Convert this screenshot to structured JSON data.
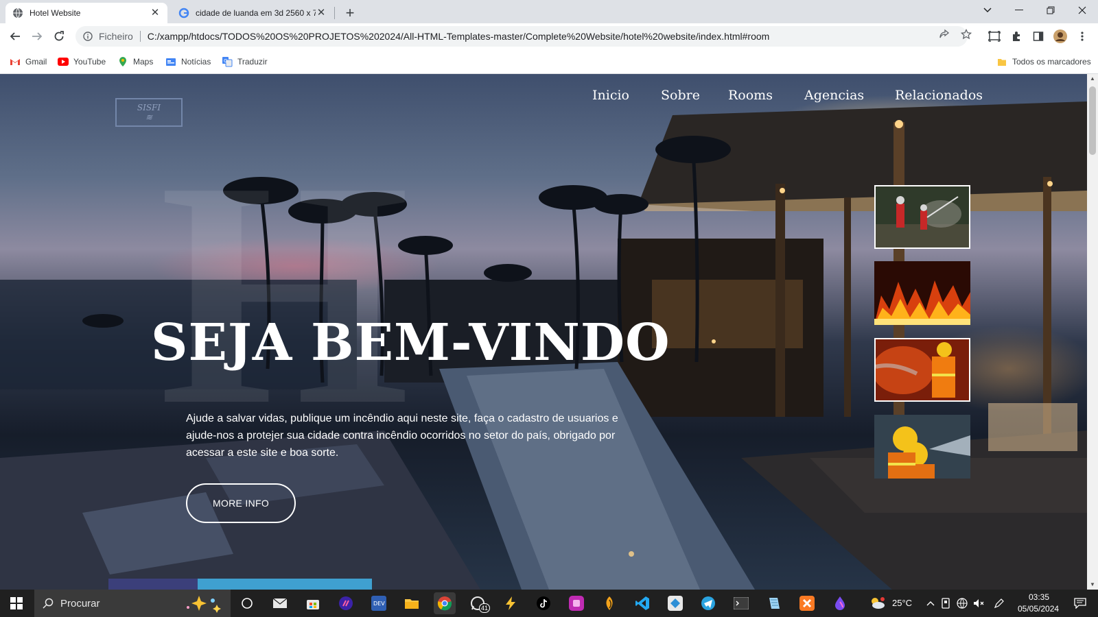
{
  "browser": {
    "tabs": [
      {
        "title": "Hotel Website",
        "active": true
      },
      {
        "title": "cidade de luanda em 3d 2560 x 7",
        "active": false
      }
    ],
    "address": {
      "scheme_label": "Ficheiro",
      "url": "C:/xampp/htdocs/TODOS%20OS%20PROJETOS%202024/All-HTML-Templates-master/Complete%20Website/hotel%20website/index.html#room"
    },
    "bookmarks": [
      {
        "label": "Gmail",
        "icon": "gmail-icon"
      },
      {
        "label": "YouTube",
        "icon": "youtube-icon"
      },
      {
        "label": "Maps",
        "icon": "maps-icon"
      },
      {
        "label": "Notícias",
        "icon": "news-icon"
      },
      {
        "label": "Traduzir",
        "icon": "translate-icon"
      }
    ],
    "bookmarks_folder": "Todos os marcadores"
  },
  "page": {
    "logo_text": "SISFI",
    "logo_sub": "≋",
    "background_letter": "H",
    "nav": [
      "Inicio",
      "Sobre",
      "Rooms",
      "Agencias",
      "Relacionados"
    ],
    "headline": "SEJA BEM-VINDO",
    "paragraph": "Ajude a salvar vidas, publique um incêndio aqui neste site, faça o cadastro de usuarios e ajude-nos a protejer sua cidade contra incêndio ocorridos no setor do país, obrigado por acessar a este site e boa sorte.",
    "button": "MORE INFO",
    "thumbnails": [
      "firefighters-forest-image",
      "flames-image",
      "firefighter-hose-image",
      "firefighters-helmets-image"
    ]
  },
  "taskbar": {
    "search_placeholder": "Procurar",
    "whatsapp_badge": "41",
    "weather": "25°C",
    "time": "03:35",
    "date": "05/05/2024"
  },
  "colors": {
    "accent_blue": "#3fa0d0",
    "accent_indigo": "#3b3f7a",
    "taskbar": "#202020"
  }
}
